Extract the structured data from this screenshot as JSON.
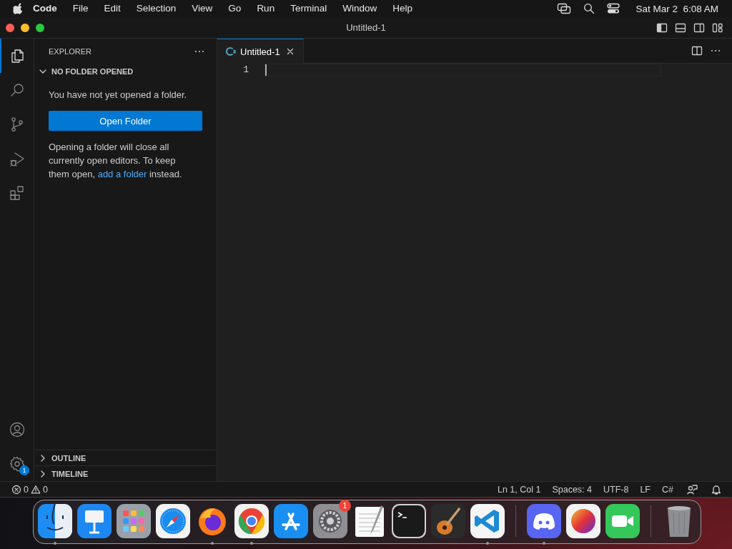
{
  "menubar": {
    "items": [
      {
        "label": "Code",
        "bold": true
      },
      {
        "label": "File",
        "bold": false
      },
      {
        "label": "Edit",
        "bold": false
      },
      {
        "label": "Selection",
        "bold": false
      },
      {
        "label": "View",
        "bold": false
      },
      {
        "label": "Go",
        "bold": false
      },
      {
        "label": "Run",
        "bold": false
      },
      {
        "label": "Terminal",
        "bold": false
      },
      {
        "label": "Window",
        "bold": false
      },
      {
        "label": "Help",
        "bold": false
      }
    ],
    "clock": "Sat Mar 2  6:08 AM"
  },
  "window": {
    "title": "Untitled-1",
    "layout_toggles": [
      {
        "kind": "primary-sidebar",
        "on": true
      },
      {
        "kind": "panel",
        "on": false
      },
      {
        "kind": "secondary-sidebar",
        "on": false
      }
    ]
  },
  "activity_bar": {
    "items": [
      {
        "kind": "explorer",
        "selected": true
      },
      {
        "kind": "search",
        "selected": false
      },
      {
        "kind": "source-control",
        "selected": false
      },
      {
        "kind": "run",
        "selected": false
      },
      {
        "kind": "extensions",
        "selected": false
      }
    ],
    "bottom": [
      {
        "kind": "accounts"
      },
      {
        "kind": "manage",
        "badge": "1"
      }
    ]
  },
  "sidebar": {
    "title": "EXPLORER",
    "section": {
      "title": "NO FOLDER OPENED",
      "expanded": true,
      "message": "You have not yet opened a folder.",
      "button": "Open Folder",
      "note": {
        "before": "Opening a folder will close all currently open editors. To keep them open, ",
        "link": "add a folder",
        "after": " instead."
      }
    },
    "panels": [
      {
        "title": "OUTLINE",
        "expanded": false
      },
      {
        "title": "TIMELINE",
        "expanded": false
      }
    ]
  },
  "editor": {
    "tabs": [
      {
        "label": "Untitled-1",
        "selected": true
      }
    ],
    "line_numbers": [
      "1"
    ]
  },
  "status_bar": {
    "errors": "0",
    "warnings": "0",
    "items": [
      "Ln 1, Col 1",
      "Spaces: 4",
      "UTF-8",
      "LF",
      "C#"
    ]
  },
  "dock": {
    "items": [
      {
        "kind": "finder",
        "running": true
      },
      {
        "kind": "keynote",
        "running": false
      },
      {
        "kind": "launchpad",
        "running": false
      },
      {
        "kind": "safari",
        "running": false
      },
      {
        "kind": "firefox",
        "running": true
      },
      {
        "kind": "chrome",
        "running": true
      },
      {
        "kind": "app-store",
        "running": false
      },
      {
        "kind": "settings",
        "running": false,
        "badge": "1"
      },
      {
        "kind": "textedit",
        "running": false
      },
      {
        "kind": "terminal",
        "running": false
      },
      {
        "kind": "garageband",
        "running": false
      },
      {
        "kind": "vscode",
        "running": true
      },
      {
        "kind": "separator"
      },
      {
        "kind": "discord",
        "running": true
      },
      {
        "kind": "color",
        "running": false
      },
      {
        "kind": "facetime",
        "running": false
      },
      {
        "kind": "separator"
      },
      {
        "kind": "trash",
        "running": false
      }
    ]
  }
}
